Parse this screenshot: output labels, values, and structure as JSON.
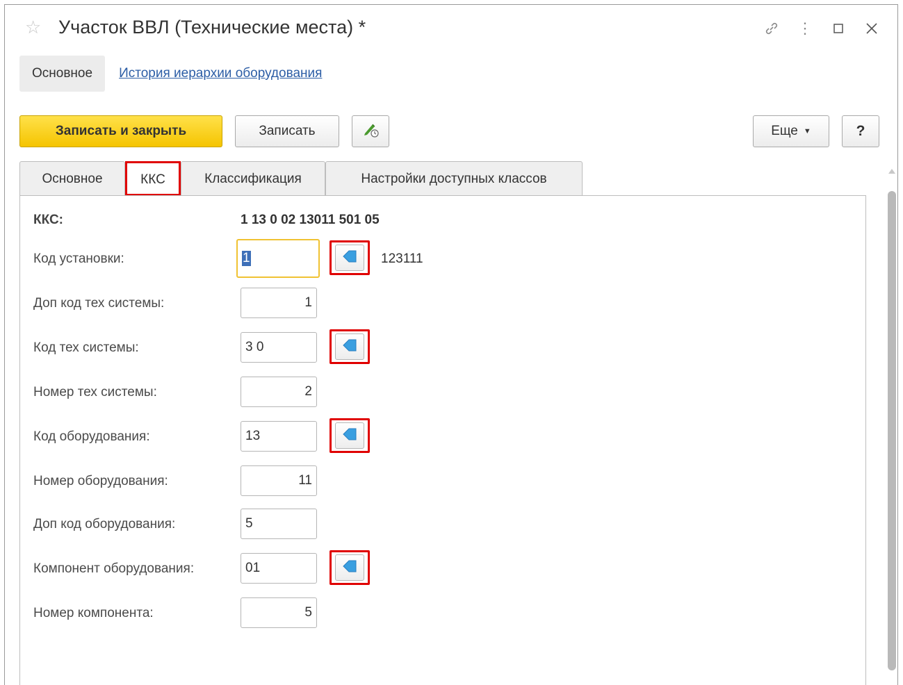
{
  "window": {
    "title": "Участок ВВЛ (Технические места) *",
    "icons": [
      "star-icon",
      "link-icon",
      "more-icon",
      "maximize-icon",
      "close-icon"
    ]
  },
  "sections": {
    "active": "Основное",
    "link": "История иерархии оборудования"
  },
  "toolbar": {
    "save_close_label": "Записать и закрыть",
    "save_label": "Записать",
    "more_label": "Еще",
    "help_label": "?"
  },
  "tabs": [
    {
      "label": "Основное"
    },
    {
      "label": "ККС"
    },
    {
      "label": "Классификация"
    },
    {
      "label": "Настройки доступных классов"
    }
  ],
  "active_tab": "ККС",
  "form": {
    "kks_label": "ККС:",
    "kks_value": "1 13 0 02 13011 501 05",
    "rows": [
      {
        "label": "Код установки:",
        "value": "1",
        "has_button": true,
        "side_text": "123111"
      },
      {
        "label": "Доп код тех системы:",
        "value": "1",
        "has_button": false
      },
      {
        "label": "Код тех системы:",
        "value": "3 0",
        "has_button": true
      },
      {
        "label": "Номер тех системы:",
        "value": "2",
        "has_button": false
      },
      {
        "label": "Код оборудования:",
        "value": "13",
        "has_button": true
      },
      {
        "label": "Номер оборудования:",
        "value": "11",
        "has_button": false
      },
      {
        "label": "Доп код оборудования:",
        "value": "5",
        "has_button": false
      },
      {
        "label": "Компонент оборудования:",
        "value": "01",
        "has_button": true
      },
      {
        "label": "Номер компонента:",
        "value": "5",
        "has_button": false
      }
    ]
  },
  "colors": {
    "accent_yellow": "#f5c400",
    "highlight_red": "#e00000",
    "link_blue": "#2d5ea6",
    "arrow_blue": "#3a9fe0"
  }
}
